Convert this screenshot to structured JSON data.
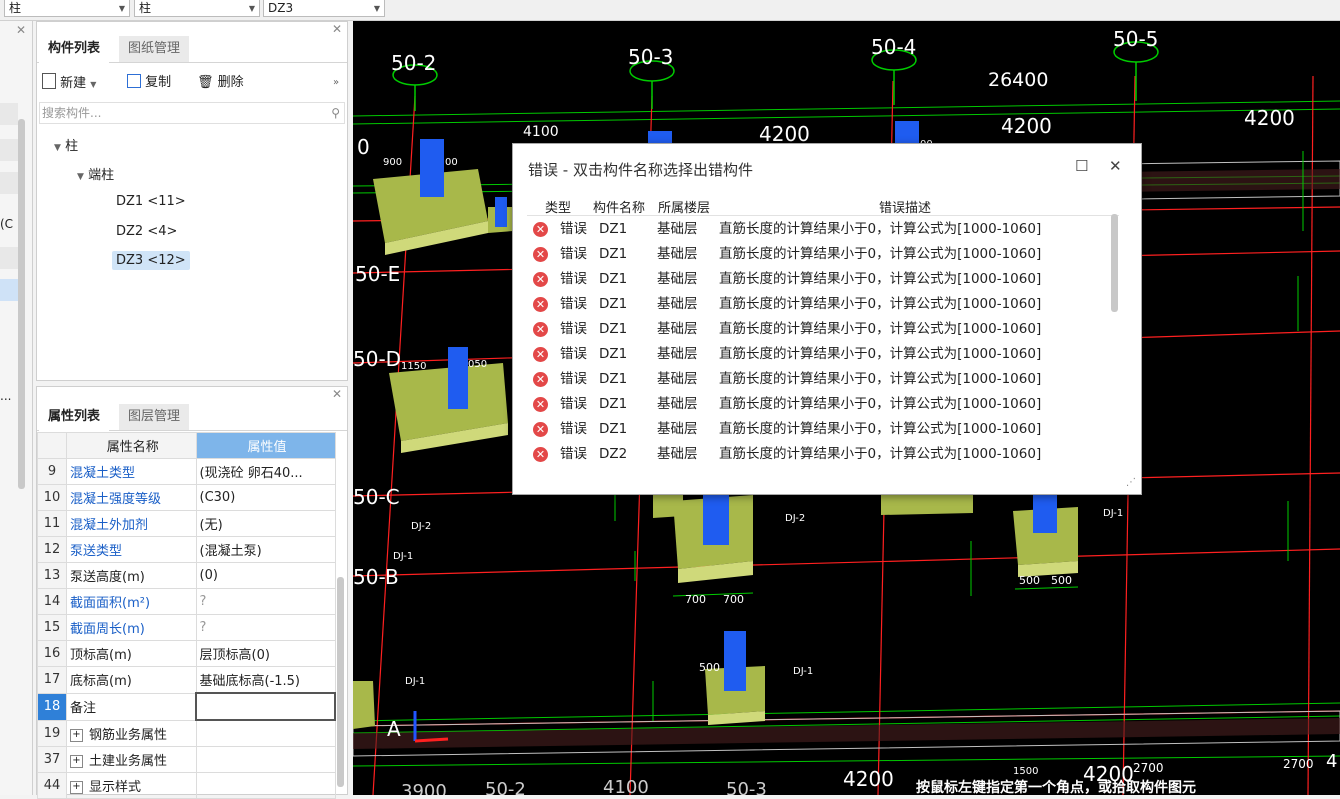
{
  "selectors": [
    {
      "value": "柱"
    },
    {
      "value": "柱"
    },
    {
      "value": "DZ3"
    }
  ],
  "left_strip": {
    "label_c": "(C",
    "label_dots": "..."
  },
  "component_panel": {
    "tabs": [
      "构件列表",
      "图纸管理"
    ],
    "toolbar": {
      "new": "新建",
      "copy": "复制",
      "delete": "删除"
    },
    "search_placeholder": "搜索构件...",
    "tree": {
      "root": "柱",
      "group": "端柱",
      "items": [
        "DZ1 <11>",
        "DZ2 <4>",
        "DZ3 <12>"
      ]
    }
  },
  "property_panel": {
    "tabs": [
      "属性列表",
      "图层管理"
    ],
    "col_name": "属性名称",
    "col_value": "属性值",
    "rows": [
      {
        "num": "9",
        "name": "混凝土类型",
        "value": "(现浇砼 卵石40...",
        "blue": true
      },
      {
        "num": "10",
        "name": "混凝土强度等级",
        "value": "(C30)",
        "blue": true
      },
      {
        "num": "11",
        "name": "混凝土外加剂",
        "value": "(无)",
        "blue": true
      },
      {
        "num": "12",
        "name": "泵送类型",
        "value": "(混凝土泵)",
        "blue": true
      },
      {
        "num": "13",
        "name": "泵送高度(m)",
        "value": "(0)",
        "blue": false
      },
      {
        "num": "14",
        "name": "截面面积(m²)",
        "value": "?",
        "blue": true
      },
      {
        "num": "15",
        "name": "截面周长(m)",
        "value": "?",
        "blue": true
      },
      {
        "num": "16",
        "name": "顶标高(m)",
        "value": "层顶标高(0)",
        "blue": false
      },
      {
        "num": "17",
        "name": "底标高(m)",
        "value": "基础底标高(-1.5)",
        "blue": false
      },
      {
        "num": "18",
        "name": "备注",
        "value": "",
        "blue": false
      }
    ],
    "groups": [
      {
        "num": "19",
        "name": "钢筋业务属性"
      },
      {
        "num": "37",
        "name": "土建业务属性"
      },
      {
        "num": "44",
        "name": "显示样式"
      }
    ]
  },
  "cad": {
    "axis_top": [
      "50-2",
      "50-3",
      "50-4",
      "50-5"
    ],
    "axis_left": [
      "50-E",
      "50-D",
      "50-C",
      "50-B",
      "A"
    ],
    "dims": [
      "26400",
      "4200",
      "4200",
      "4200",
      "4100",
      "4200"
    ],
    "bottom_labels": [
      "3900",
      "50-2",
      "4100",
      "50-3",
      "4200",
      "4200",
      "2700",
      "4"
    ],
    "small_labels": [
      "DJ-2",
      "DJ-1",
      "DJ-2",
      "DJ-1",
      "DJ-1",
      "DJ-1",
      "700",
      "700",
      "500",
      "500",
      "500",
      "900",
      "1150",
      "050",
      "00",
      "00",
      "0",
      "1500",
      "2700"
    ],
    "status_hint": "按鼠标左键指定第一个角点，或拾取构件图元"
  },
  "error_dialog": {
    "title": "错误 - 双击构件名称选择出错构件",
    "columns": {
      "type": "类型",
      "name": "构件名称",
      "floor": "所属楼层",
      "desc": "错误描述"
    },
    "rows": [
      {
        "type": "错误",
        "name": "DZ1",
        "floor": "基础层",
        "desc": "直筋长度的计算结果小于0，计算公式为[1000-1060]"
      },
      {
        "type": "错误",
        "name": "DZ1",
        "floor": "基础层",
        "desc": "直筋长度的计算结果小于0，计算公式为[1000-1060]"
      },
      {
        "type": "错误",
        "name": "DZ1",
        "floor": "基础层",
        "desc": "直筋长度的计算结果小于0，计算公式为[1000-1060]"
      },
      {
        "type": "错误",
        "name": "DZ1",
        "floor": "基础层",
        "desc": "直筋长度的计算结果小于0，计算公式为[1000-1060]"
      },
      {
        "type": "错误",
        "name": "DZ1",
        "floor": "基础层",
        "desc": "直筋长度的计算结果小于0，计算公式为[1000-1060]"
      },
      {
        "type": "错误",
        "name": "DZ1",
        "floor": "基础层",
        "desc": "直筋长度的计算结果小于0，计算公式为[1000-1060]"
      },
      {
        "type": "错误",
        "name": "DZ1",
        "floor": "基础层",
        "desc": "直筋长度的计算结果小于0，计算公式为[1000-1060]"
      },
      {
        "type": "错误",
        "name": "DZ1",
        "floor": "基础层",
        "desc": "直筋长度的计算结果小于0，计算公式为[1000-1060]"
      },
      {
        "type": "错误",
        "name": "DZ1",
        "floor": "基础层",
        "desc": "直筋长度的计算结果小于0，计算公式为[1000-1060]"
      },
      {
        "type": "错误",
        "name": "DZ2",
        "floor": "基础层",
        "desc": "直筋长度的计算结果小于0，计算公式为[1000-1060]"
      }
    ]
  },
  "colors": {
    "cad_bg": "#000000",
    "column": "#1f5cf0",
    "footing": "#a8b84a",
    "axis": "#ff2020",
    "grid_line": "#00cc00",
    "accent": "#7eb5ea"
  }
}
